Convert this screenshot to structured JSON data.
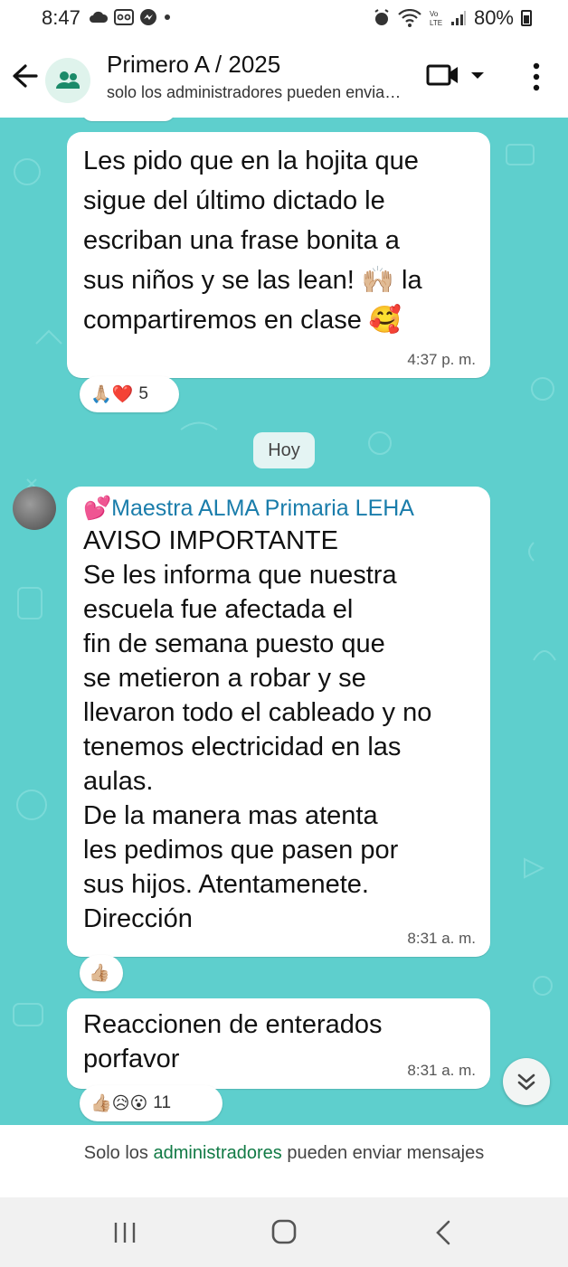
{
  "status_bar": {
    "time": "8:47",
    "battery": "80%",
    "icons": [
      "cloud-icon",
      "voicemail-icon",
      "messenger-icon",
      "dot-icon",
      "alarm-icon",
      "wifi-icon",
      "volte-icon",
      "signal-icon",
      "battery-icon"
    ]
  },
  "header": {
    "title": "Primero A / 2025",
    "subtitle": "solo los administradores pueden enviar mensajes"
  },
  "messages": [
    {
      "text": "Les pido que en la hojita que\nsigue del último dictado le\nescriban una frase bonita a\nsus niños y se las lean! 🙌🏼 la\ncompartiremos en clase 🥰",
      "time": "4:37 p. m.",
      "reactions": {
        "emojis": "🙏🏼❤️",
        "count": "5"
      }
    },
    {
      "sender": "💕Maestra ALMA Primaria LEHA",
      "text": "AVISO IMPORTANTE\nSe les informa que nuestra\nescuela fue afectada el\nfin de semana puesto que\nse metieron a robar  y se\nllevaron todo el cableado y no\ntenemos electricidad en las\naulas.\nDe la manera mas atenta\nles pedimos que pasen por\nsus hijos. Atentamenete.\nDirección",
      "time": "8:31 a. m.",
      "reactions": {
        "emojis": "👍🏼"
      }
    },
    {
      "text": "Reaccionen de enterados\nporfavor",
      "time": "8:31 a. m.",
      "reactions": {
        "emojis": "👍🏼😥😮",
        "count": "11"
      }
    }
  ],
  "date_divider": "Hoy",
  "footer": {
    "prefix": "Solo los ",
    "link": "administradores",
    "suffix": " pueden enviar mensajes"
  },
  "colors": {
    "chat_background": "#5ecfcd",
    "sender_name": "#1a7dab",
    "footer_link": "#117a45"
  }
}
